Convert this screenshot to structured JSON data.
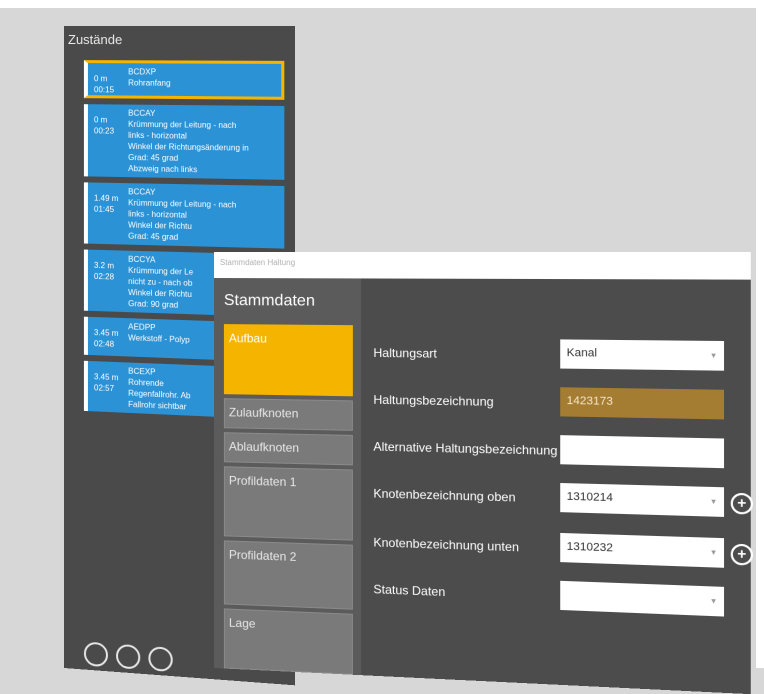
{
  "zustaende": {
    "title": "Zustände",
    "items": [
      {
        "dist": "0 m",
        "time": "00:15",
        "lines": [
          "BCDXP",
          "Rohranfang"
        ],
        "selected": true
      },
      {
        "dist": "0 m",
        "time": "00:23",
        "lines": [
          "BCCAY",
          "Krümmung der Leitung - nach",
          "links - horizontal",
          "Winkel der Richtungsänderung in",
          "Grad: 45 grad",
          "Abzweig nach links"
        ],
        "selected": false
      },
      {
        "dist": "1.49 m",
        "time": "01:45",
        "lines": [
          "BCCAY",
          "Krümmung der Leitung - nach",
          "links - horizontal",
          "Winkel der Richtu",
          "Grad: 45 grad"
        ],
        "selected": false
      },
      {
        "dist": "3.2 m",
        "time": "02:28",
        "lines": [
          "BCCYA",
          "Krümmung der Le",
          "nicht zu - nach ob",
          "Winkel der Richtu",
          "Grad: 90 grad"
        ],
        "selected": false
      },
      {
        "dist": "3.45 m",
        "time": "02:48",
        "lines": [
          "AEDPP",
          "Werkstoff - Polyp"
        ],
        "selected": false
      },
      {
        "dist": "3.45 m",
        "time": "02:57",
        "lines": [
          "BCEXP",
          "Rohrende",
          "Regenfallrohr. Ab",
          "Fallrohr sichtbar"
        ],
        "selected": false
      }
    ]
  },
  "stammdaten": {
    "window_title": "Stammdaten Haltung",
    "heading": "Stammdaten",
    "nav": [
      "Aufbau",
      "Zulaufknoten",
      "Ablaufknoten",
      "Profildaten 1",
      "Profildaten 2",
      "Lage"
    ],
    "active_nav": "Aufbau",
    "fields": [
      {
        "label": "Haltungsart",
        "value": "Kanal",
        "type": "select"
      },
      {
        "label": "Haltungsbezeichnung",
        "value": "1423173",
        "type": "text"
      },
      {
        "label": "Alternative Haltungsbezeichnung",
        "value": "",
        "type": "text"
      },
      {
        "label": "Knotenbezeichnung oben",
        "value": "1310214",
        "type": "select"
      },
      {
        "label": "Knotenbezeichnung unten",
        "value": "1310232",
        "type": "select"
      },
      {
        "label": "Status Daten",
        "value": "",
        "type": "select"
      }
    ],
    "add_icon": "plus-circle-icon",
    "caret_icon": "chevron-down-icon"
  },
  "colors": {
    "accent": "#f4b400",
    "item_blue": "#2b92d6",
    "highlight_field": "#a57d32",
    "panel_dark": "#4a4a4a"
  }
}
